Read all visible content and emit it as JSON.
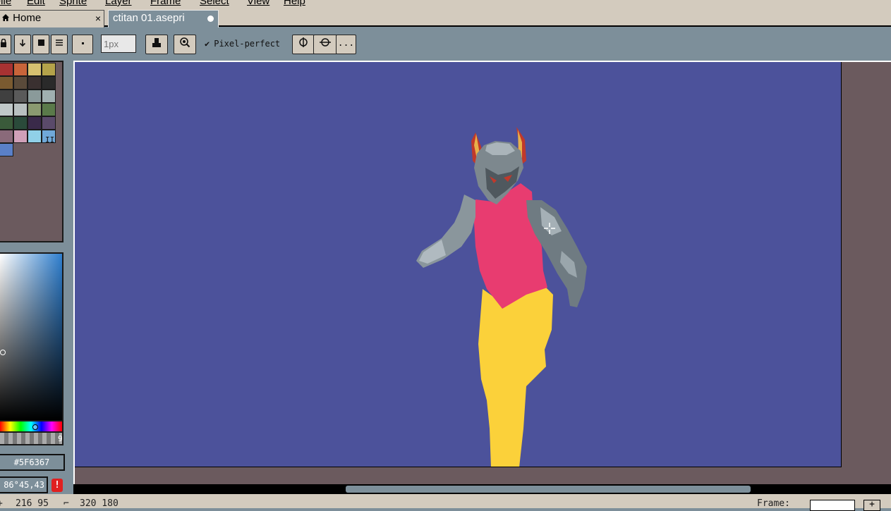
{
  "menu": [
    "File",
    "Edit",
    "Sprite",
    "Layer",
    "Frame",
    "Select",
    "View",
    "Help"
  ],
  "tabs": {
    "home_label": "Home",
    "home_close": "×",
    "file_label": "ctitan 01.asepri"
  },
  "toolbar": {
    "brush_size_placeholder": "1px",
    "pixel_perfect_label": "Pixel-perfect",
    "more_label": "..."
  },
  "palette": {
    "swatches": [
      "#a83232",
      "#c8643a",
      "#d6c070",
      "#b4a24a",
      "#7a5a30",
      "#5a4a3a",
      "#3a3030",
      "#2a2a2a",
      "#404040",
      "#5a5a5a",
      "#8a9a9a",
      "#a0b0b0",
      "#c0c8c8",
      "#b8c0c0",
      "#8a9a70",
      "#5a7a4a",
      "#3a5a3a",
      "#2a4a3a",
      "#3a2a4a",
      "#5a4a6a",
      "#8a6a7a",
      "#d0a0b8",
      "#90d0e8",
      "#70a8d8",
      "#5a80c8"
    ],
    "index_marker": "II"
  },
  "color": {
    "hex": "#5F6367",
    "hsv": "86°45,43",
    "warning_icon": "!",
    "alpha_label": "9"
  },
  "status": {
    "position": "216 95",
    "size": "320 180",
    "frame_label": "Frame:",
    "add_frame": "+"
  },
  "colors": {
    "ui_background": "#7d8f9a",
    "menu_background": "#d3cbbe",
    "canvas_background": "#4c529b",
    "workspace": "#6b5a5e",
    "armor": "#8a969c",
    "top": "#e83c70",
    "legs": "#fbd13a"
  }
}
